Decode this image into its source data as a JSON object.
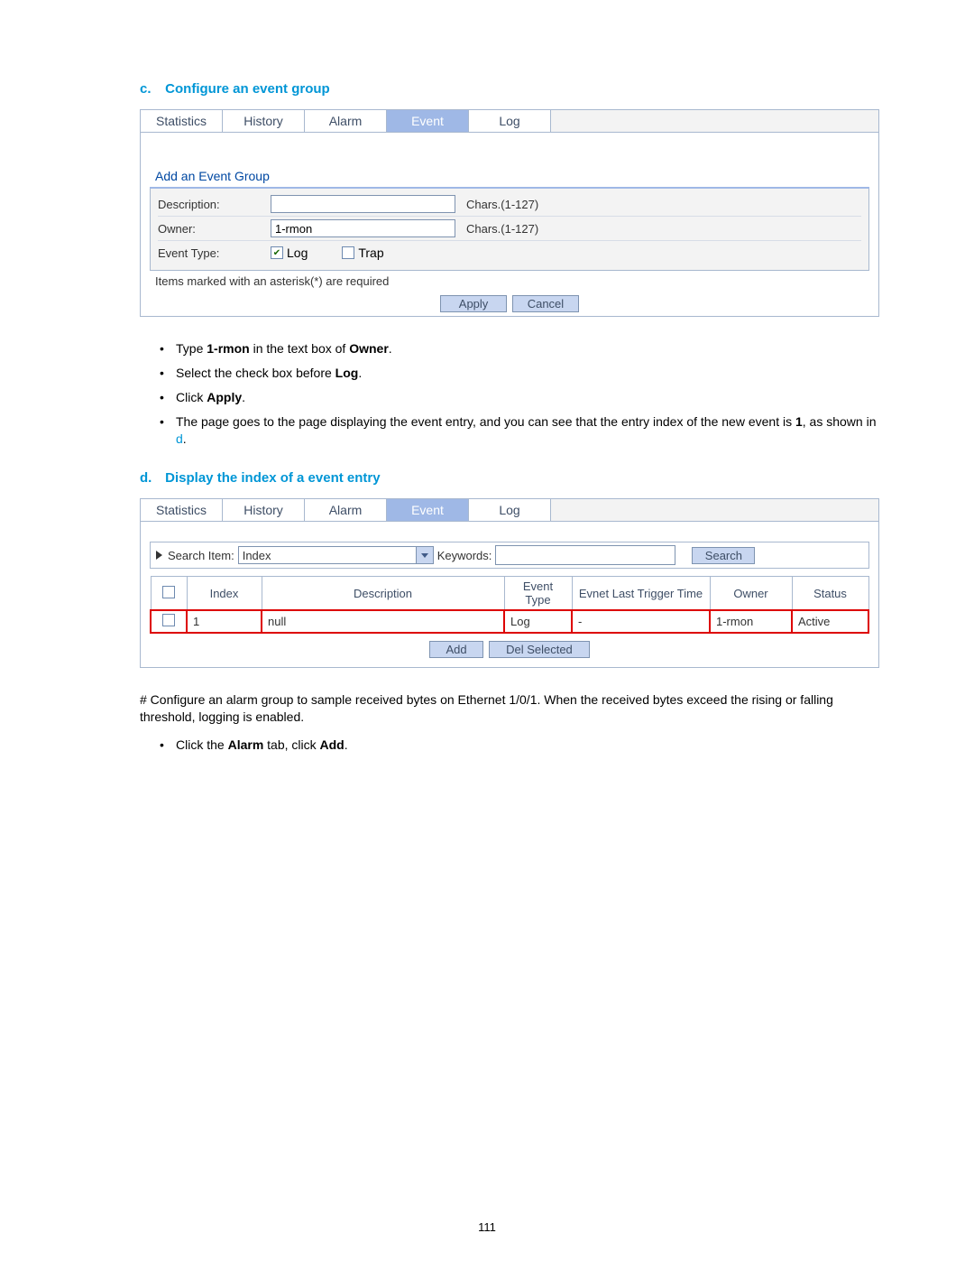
{
  "section_c": {
    "letter": "c.",
    "title": "Configure an event group"
  },
  "fig1": {
    "tabs": [
      "Statistics",
      "History",
      "Alarm",
      "Event",
      "Log"
    ],
    "active_tab_index": 3,
    "form_title": "Add an Event Group",
    "rows": {
      "description": {
        "label": "Description:",
        "value": "",
        "hint": "Chars.(1-127)"
      },
      "owner": {
        "label": "Owner:",
        "value": "1-rmon",
        "hint": "Chars.(1-127)"
      },
      "event_type": {
        "label": "Event Type:",
        "log_label": "Log",
        "trap_label": "Trap",
        "log_checked": true,
        "trap_checked": false
      }
    },
    "required_note": "Items marked with an asterisk(*) are required",
    "apply": "Apply",
    "cancel": "Cancel"
  },
  "bullets_c": {
    "b1_pre": "Type ",
    "b1_bold1": "1-rmon",
    "b1_mid": " in the text box of ",
    "b1_bold2": "Owner",
    "b1_post": ".",
    "b2_pre": "Select the check box before ",
    "b2_bold": "Log",
    "b2_post": ".",
    "b3_pre": "Click ",
    "b3_bold": "Apply",
    "b3_post": ".",
    "b4_pre": "The page goes to the page displaying the event entry, and you can see that the entry index of the new event is ",
    "b4_bold": "1",
    "b4_mid": ", as shown in ",
    "b4_link": "d",
    "b4_post": "."
  },
  "section_d": {
    "letter": "d.",
    "title": "Display the index of a event entry"
  },
  "fig2": {
    "tabs": [
      "Statistics",
      "History",
      "Alarm",
      "Event",
      "Log"
    ],
    "active_tab_index": 3,
    "search": {
      "label": "Search Item:",
      "select_value": "Index",
      "keywords_label": "Keywords:",
      "button": "Search"
    },
    "headers": {
      "index": "Index",
      "description": "Description",
      "event_type": "Event Type",
      "last_trigger": "Evnet Last Trigger Time",
      "owner": "Owner",
      "status": "Status"
    },
    "row": {
      "index": "1",
      "description": "null",
      "event_type": "Log",
      "last_trigger": "-",
      "owner": "1-rmon",
      "status": "Active"
    },
    "add": "Add",
    "del": "Del Selected"
  },
  "after_para": "# Configure an alarm group to sample received bytes on Ethernet 1/0/1. When the received bytes exceed the rising or falling threshold, logging is enabled.",
  "after_bullet": {
    "pre": "Click the ",
    "b1": "Alarm",
    "mid": " tab, click ",
    "b2": "Add",
    "post": "."
  },
  "page_number": "111"
}
